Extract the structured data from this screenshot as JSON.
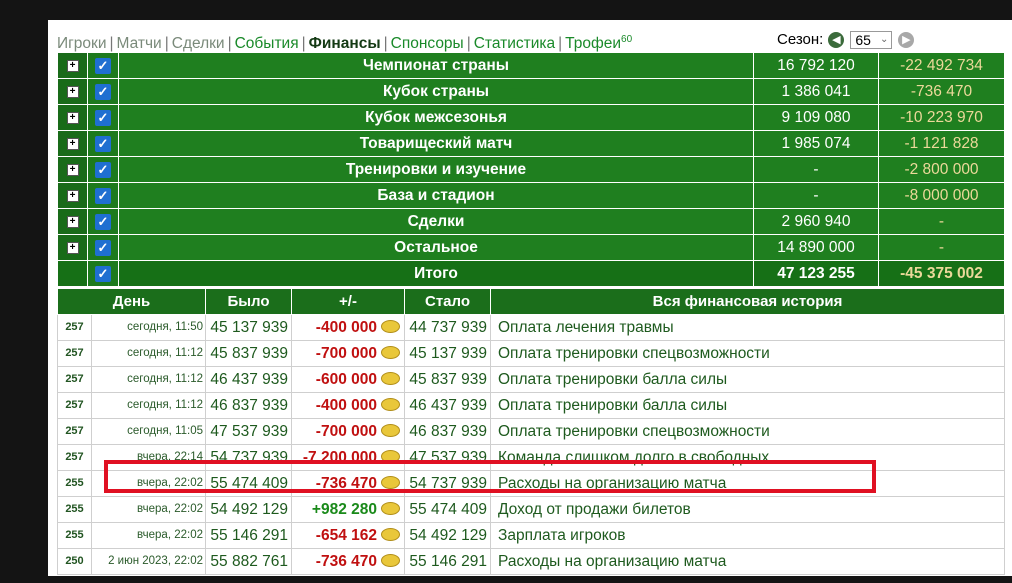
{
  "nav": {
    "tabs": [
      {
        "label": "Игроки",
        "state": "dim"
      },
      {
        "label": "Матчи",
        "state": "dim"
      },
      {
        "label": "Сделки",
        "state": "dim"
      },
      {
        "label": "События",
        "state": "normal"
      },
      {
        "label": "Финансы",
        "state": "active"
      },
      {
        "label": "Спонсоры",
        "state": "normal"
      },
      {
        "label": "Статистика",
        "state": "normal"
      },
      {
        "label": "Трофеи",
        "state": "normal",
        "sup": "60"
      }
    ],
    "separator": "|"
  },
  "season": {
    "label": "Сезон:",
    "value": "65",
    "prev_icon": "arrow-left-icon",
    "next_icon": "arrow-right-icon"
  },
  "summary": {
    "rows": [
      {
        "name": "Чемпионат страны",
        "income": "16 792 120",
        "expense": "-22 492 734"
      },
      {
        "name": "Кубок страны",
        "income": "1 386 041",
        "expense": "-736 470"
      },
      {
        "name": "Кубок межсезонья",
        "income": "9 109 080",
        "expense": "-10 223 970"
      },
      {
        "name": "Товарищеский матч",
        "income": "1 985 074",
        "expense": "-1 121 828"
      },
      {
        "name": "Тренировки и изучение",
        "income": "-",
        "expense": "-2 800 000"
      },
      {
        "name": "База и стадион",
        "income": "-",
        "expense": "-8 000 000"
      },
      {
        "name": "Сделки",
        "income": "2 960 940",
        "expense": "-"
      },
      {
        "name": "Остальное",
        "income": "14 890 000",
        "expense": "-"
      }
    ],
    "total": {
      "name": "Итого",
      "income": "47 123 255",
      "expense": "-45 375 002"
    },
    "expand_symbol": "+",
    "check_symbol": "✓"
  },
  "history": {
    "headers": {
      "day": "День",
      "before": "Было",
      "change": "+/-",
      "after": "Стало",
      "description": "Вся финансовая история"
    },
    "rows": [
      {
        "day": "257",
        "time": "сегодня, 11:50",
        "before": "45 137 939",
        "change": "-400 000",
        "after": "44 737 939",
        "description": "Оплата лечения травмы",
        "sign": "neg"
      },
      {
        "day": "257",
        "time": "сегодня, 11:12",
        "before": "45 837 939",
        "change": "-700 000",
        "after": "45 137 939",
        "description": "Оплата тренировки спецвозможности",
        "sign": "neg"
      },
      {
        "day": "257",
        "time": "сегодня, 11:12",
        "before": "46 437 939",
        "change": "-600 000",
        "after": "45 837 939",
        "description": "Оплата тренировки балла силы",
        "sign": "neg"
      },
      {
        "day": "257",
        "time": "сегодня, 11:12",
        "before": "46 837 939",
        "change": "-400 000",
        "after": "46 437 939",
        "description": "Оплата тренировки балла силы",
        "sign": "neg"
      },
      {
        "day": "257",
        "time": "сегодня, 11:05",
        "before": "47 537 939",
        "change": "-700 000",
        "after": "46 837 939",
        "description": "Оплата тренировки спецвозможности",
        "sign": "neg"
      },
      {
        "day": "257",
        "time": "вчера, 22:14",
        "before": "54 737 939",
        "change": "-7 200 000",
        "after": "47 537 939",
        "description": "Команда слишком долго в свободных",
        "sign": "neg"
      },
      {
        "day": "255",
        "time": "вчера, 22:02",
        "before": "55 474 409",
        "change": "-736 470",
        "after": "54 737 939",
        "description": "Расходы на организацию матча",
        "sign": "neg"
      },
      {
        "day": "255",
        "time": "вчера, 22:02",
        "before": "54 492 129",
        "change": "+982 280",
        "after": "55 474 409",
        "description": "Доход от продажи билетов",
        "sign": "pos"
      },
      {
        "day": "255",
        "time": "вчера, 22:02",
        "before": "55 146 291",
        "change": "-654 162",
        "after": "54 492 129",
        "description": "Зарплата игроков",
        "sign": "neg"
      },
      {
        "day": "250",
        "time": "2 июн 2023, 22:02",
        "before": "55 882 761",
        "change": "-736 470",
        "after": "55 146 291",
        "description": "Расходы на организацию матча",
        "sign": "neg"
      }
    ]
  },
  "colors": {
    "header_green": "#1b6e1b",
    "cell_green": "#1f7f1f",
    "negative": "#c01010",
    "positive": "#1a8a1a",
    "highlight": "#e01022",
    "checkbox": "#1f6fd1"
  },
  "icons": {
    "coin": "coin-icon"
  }
}
